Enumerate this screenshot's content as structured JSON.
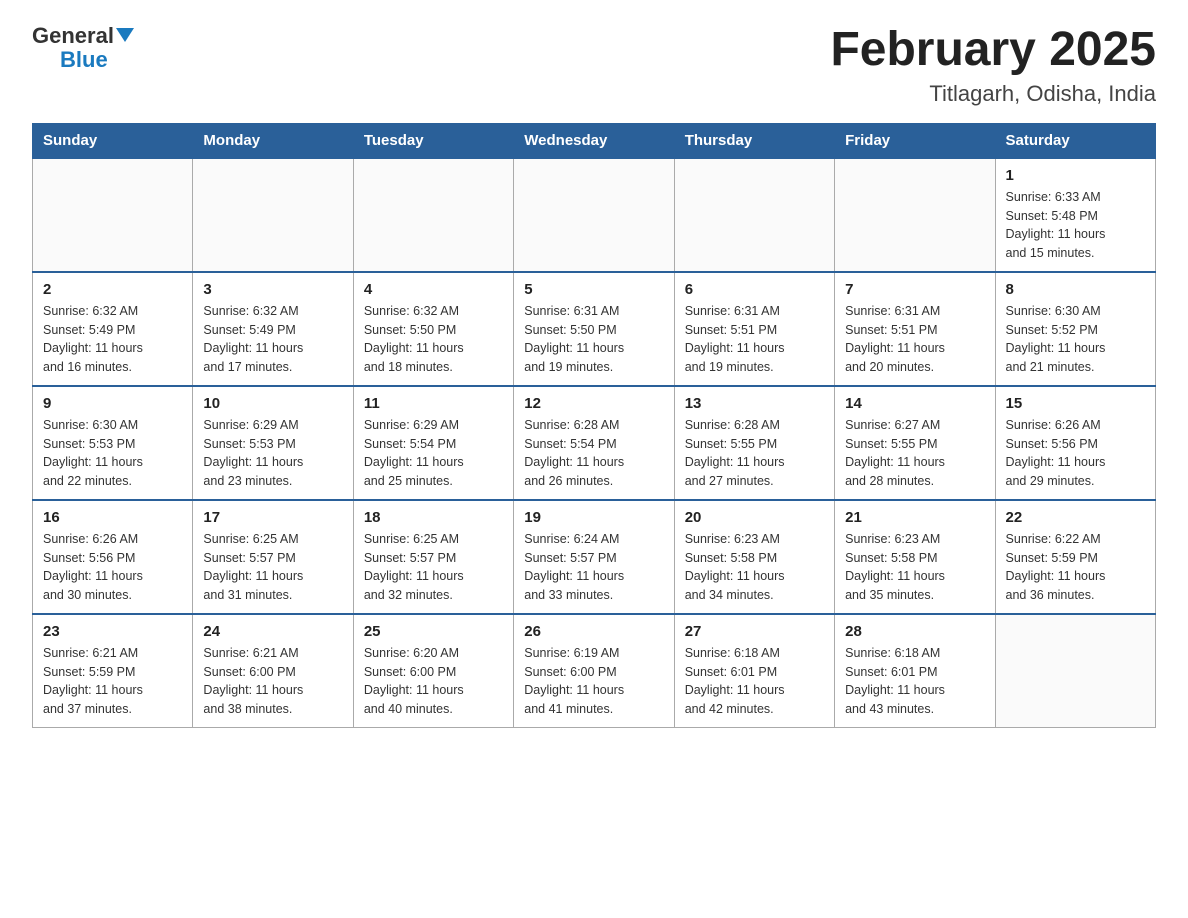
{
  "header": {
    "logo_general": "General",
    "logo_blue": "Blue",
    "title": "February 2025",
    "subtitle": "Titlagarh, Odisha, India"
  },
  "days_of_week": [
    "Sunday",
    "Monday",
    "Tuesday",
    "Wednesday",
    "Thursday",
    "Friday",
    "Saturday"
  ],
  "weeks": [
    [
      {
        "day": "",
        "info": ""
      },
      {
        "day": "",
        "info": ""
      },
      {
        "day": "",
        "info": ""
      },
      {
        "day": "",
        "info": ""
      },
      {
        "day": "",
        "info": ""
      },
      {
        "day": "",
        "info": ""
      },
      {
        "day": "1",
        "info": "Sunrise: 6:33 AM\nSunset: 5:48 PM\nDaylight: 11 hours\nand 15 minutes."
      }
    ],
    [
      {
        "day": "2",
        "info": "Sunrise: 6:32 AM\nSunset: 5:49 PM\nDaylight: 11 hours\nand 16 minutes."
      },
      {
        "day": "3",
        "info": "Sunrise: 6:32 AM\nSunset: 5:49 PM\nDaylight: 11 hours\nand 17 minutes."
      },
      {
        "day": "4",
        "info": "Sunrise: 6:32 AM\nSunset: 5:50 PM\nDaylight: 11 hours\nand 18 minutes."
      },
      {
        "day": "5",
        "info": "Sunrise: 6:31 AM\nSunset: 5:50 PM\nDaylight: 11 hours\nand 19 minutes."
      },
      {
        "day": "6",
        "info": "Sunrise: 6:31 AM\nSunset: 5:51 PM\nDaylight: 11 hours\nand 19 minutes."
      },
      {
        "day": "7",
        "info": "Sunrise: 6:31 AM\nSunset: 5:51 PM\nDaylight: 11 hours\nand 20 minutes."
      },
      {
        "day": "8",
        "info": "Sunrise: 6:30 AM\nSunset: 5:52 PM\nDaylight: 11 hours\nand 21 minutes."
      }
    ],
    [
      {
        "day": "9",
        "info": "Sunrise: 6:30 AM\nSunset: 5:53 PM\nDaylight: 11 hours\nand 22 minutes."
      },
      {
        "day": "10",
        "info": "Sunrise: 6:29 AM\nSunset: 5:53 PM\nDaylight: 11 hours\nand 23 minutes."
      },
      {
        "day": "11",
        "info": "Sunrise: 6:29 AM\nSunset: 5:54 PM\nDaylight: 11 hours\nand 25 minutes."
      },
      {
        "day": "12",
        "info": "Sunrise: 6:28 AM\nSunset: 5:54 PM\nDaylight: 11 hours\nand 26 minutes."
      },
      {
        "day": "13",
        "info": "Sunrise: 6:28 AM\nSunset: 5:55 PM\nDaylight: 11 hours\nand 27 minutes."
      },
      {
        "day": "14",
        "info": "Sunrise: 6:27 AM\nSunset: 5:55 PM\nDaylight: 11 hours\nand 28 minutes."
      },
      {
        "day": "15",
        "info": "Sunrise: 6:26 AM\nSunset: 5:56 PM\nDaylight: 11 hours\nand 29 minutes."
      }
    ],
    [
      {
        "day": "16",
        "info": "Sunrise: 6:26 AM\nSunset: 5:56 PM\nDaylight: 11 hours\nand 30 minutes."
      },
      {
        "day": "17",
        "info": "Sunrise: 6:25 AM\nSunset: 5:57 PM\nDaylight: 11 hours\nand 31 minutes."
      },
      {
        "day": "18",
        "info": "Sunrise: 6:25 AM\nSunset: 5:57 PM\nDaylight: 11 hours\nand 32 minutes."
      },
      {
        "day": "19",
        "info": "Sunrise: 6:24 AM\nSunset: 5:57 PM\nDaylight: 11 hours\nand 33 minutes."
      },
      {
        "day": "20",
        "info": "Sunrise: 6:23 AM\nSunset: 5:58 PM\nDaylight: 11 hours\nand 34 minutes."
      },
      {
        "day": "21",
        "info": "Sunrise: 6:23 AM\nSunset: 5:58 PM\nDaylight: 11 hours\nand 35 minutes."
      },
      {
        "day": "22",
        "info": "Sunrise: 6:22 AM\nSunset: 5:59 PM\nDaylight: 11 hours\nand 36 minutes."
      }
    ],
    [
      {
        "day": "23",
        "info": "Sunrise: 6:21 AM\nSunset: 5:59 PM\nDaylight: 11 hours\nand 37 minutes."
      },
      {
        "day": "24",
        "info": "Sunrise: 6:21 AM\nSunset: 6:00 PM\nDaylight: 11 hours\nand 38 minutes."
      },
      {
        "day": "25",
        "info": "Sunrise: 6:20 AM\nSunset: 6:00 PM\nDaylight: 11 hours\nand 40 minutes."
      },
      {
        "day": "26",
        "info": "Sunrise: 6:19 AM\nSunset: 6:00 PM\nDaylight: 11 hours\nand 41 minutes."
      },
      {
        "day": "27",
        "info": "Sunrise: 6:18 AM\nSunset: 6:01 PM\nDaylight: 11 hours\nand 42 minutes."
      },
      {
        "day": "28",
        "info": "Sunrise: 6:18 AM\nSunset: 6:01 PM\nDaylight: 11 hours\nand 43 minutes."
      },
      {
        "day": "",
        "info": ""
      }
    ]
  ],
  "colors": {
    "header_bg": "#2a6099",
    "header_text": "#ffffff",
    "border": "#aabbcc",
    "accent": "#1a7abf"
  }
}
